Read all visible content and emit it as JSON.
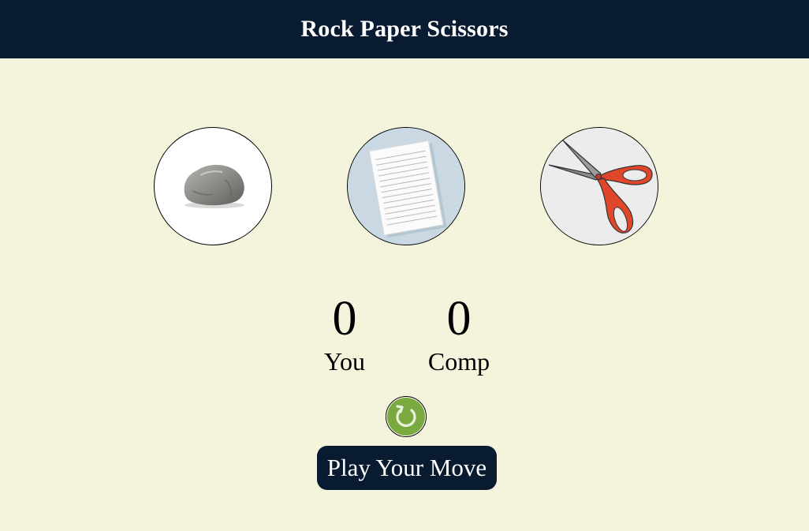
{
  "header": {
    "title": "Rock Paper Scissors"
  },
  "choices": [
    {
      "id": "rock",
      "icon": "rock-icon"
    },
    {
      "id": "paper",
      "icon": "paper-icon"
    },
    {
      "id": "scissors",
      "icon": "scissors-icon"
    }
  ],
  "scoreboard": {
    "user": {
      "score": "0",
      "label": "You"
    },
    "comp": {
      "score": "0",
      "label": "Comp"
    }
  },
  "reset": {
    "icon": "refresh-icon"
  },
  "message": {
    "text": "Play Your Move"
  },
  "colors": {
    "header_bg": "#081b31",
    "page_bg": "#f4f4dc",
    "reset_green": "#7aa940",
    "scissors_handle": "#e0462a"
  }
}
